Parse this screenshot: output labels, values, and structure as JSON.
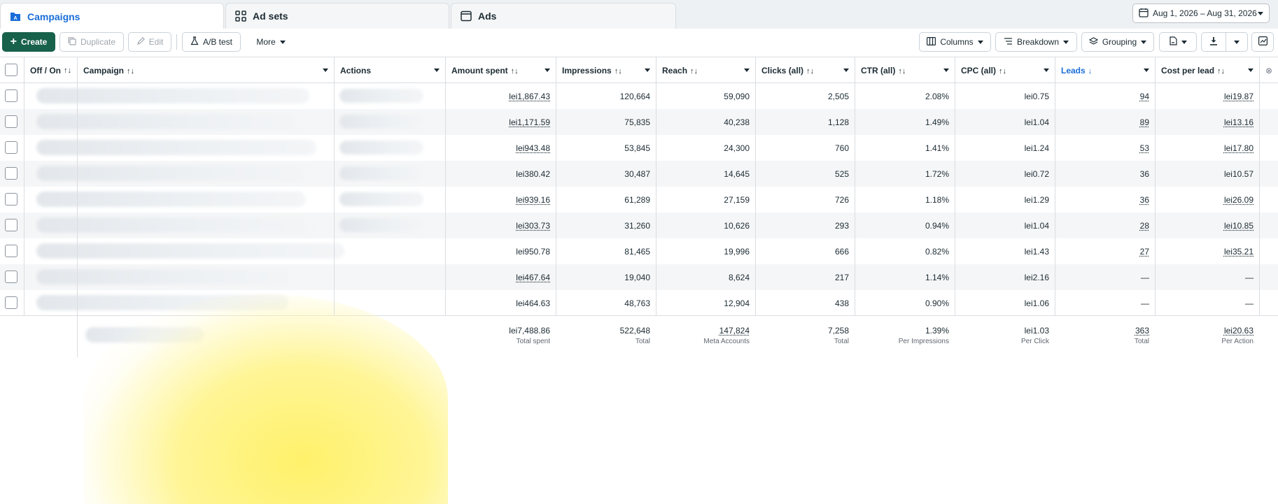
{
  "tabs": [
    {
      "label": "Campaigns",
      "icon": "campaigns-icon",
      "active": true
    },
    {
      "label": "Ad sets",
      "icon": "adsets-grid-icon",
      "active": false
    },
    {
      "label": "Ads",
      "icon": "ads-window-icon",
      "active": false
    }
  ],
  "date_range": {
    "label": "Aug 1, 2026 – Aug 31, 2026"
  },
  "toolbar": {
    "create": "Create",
    "duplicate": "Duplicate",
    "edit": "Edit",
    "ab_test": "A/B test",
    "more": "More",
    "columns": "Columns",
    "breakdown": "Breakdown",
    "grouping": "Grouping"
  },
  "columns": {
    "offon": "Off / On",
    "campaign": "Campaign",
    "actions": "Actions",
    "amount": "Amount spent",
    "impressions": "Impressions",
    "reach": "Reach",
    "clicks": "Clicks (all)",
    "ctr": "CTR (all)",
    "cpc": "CPC (all)",
    "leads": "Leads",
    "cpl": "Cost per lead"
  },
  "rows": [
    {
      "amount": "lei1,867.43",
      "impressions": "120,664",
      "reach": "59,090",
      "clicks": "2,505",
      "ctr": "2.08%",
      "cpc": "lei0.75",
      "leads": "94",
      "cpl": "lei19.87"
    },
    {
      "amount": "lei1,171.59",
      "impressions": "75,835",
      "reach": "40,238",
      "clicks": "1,128",
      "ctr": "1.49%",
      "cpc": "lei1.04",
      "leads": "89",
      "cpl": "lei13.16"
    },
    {
      "amount": "lei943.48",
      "impressions": "53,845",
      "reach": "24,300",
      "clicks": "760",
      "ctr": "1.41%",
      "cpc": "lei1.24",
      "leads": "53",
      "cpl": "lei17.80"
    },
    {
      "amount": "lei380.42",
      "impressions": "30,487",
      "reach": "14,645",
      "clicks": "525",
      "ctr": "1.72%",
      "cpc": "lei0.72",
      "leads": "36",
      "cpl": "lei10.57"
    },
    {
      "amount": "lei939.16",
      "impressions": "61,289",
      "reach": "27,159",
      "clicks": "726",
      "ctr": "1.18%",
      "cpc": "lei1.29",
      "leads": "36",
      "cpl": "lei26.09"
    },
    {
      "amount": "lei303.73",
      "impressions": "31,260",
      "reach": "10,626",
      "clicks": "293",
      "ctr": "0.94%",
      "cpc": "lei1.04",
      "leads": "28",
      "cpl": "lei10.85"
    },
    {
      "amount": "lei950.78",
      "impressions": "81,465",
      "reach": "19,996",
      "clicks": "666",
      "ctr": "0.82%",
      "cpc": "lei1.43",
      "leads": "27",
      "cpl": "lei35.21"
    },
    {
      "amount": "lei467.64",
      "impressions": "19,040",
      "reach": "8,624",
      "clicks": "217",
      "ctr": "1.14%",
      "cpc": "lei2.16",
      "leads": "—",
      "cpl": "—"
    },
    {
      "amount": "lei464.63",
      "impressions": "48,763",
      "reach": "12,904",
      "clicks": "438",
      "ctr": "0.90%",
      "cpc": "lei1.06",
      "leads": "—",
      "cpl": "—"
    }
  ],
  "totals": {
    "amount": "lei7,488.86",
    "amount_sub": "Total spent",
    "impressions": "522,648",
    "impressions_sub": "Total",
    "reach": "147,824",
    "reach_sub": "Meta Accounts",
    "clicks": "7,258",
    "clicks_sub": "Total",
    "ctr": "1.39%",
    "ctr_sub": "Per Impressions",
    "cpc": "lei1.03",
    "cpc_sub": "Per Click",
    "leads": "363",
    "leads_sub": "Total",
    "cpl": "lei20.63",
    "cpl_sub": "Per Action"
  },
  "colors": {
    "accent": "#1a6ed8",
    "create_green": "#18614b"
  }
}
